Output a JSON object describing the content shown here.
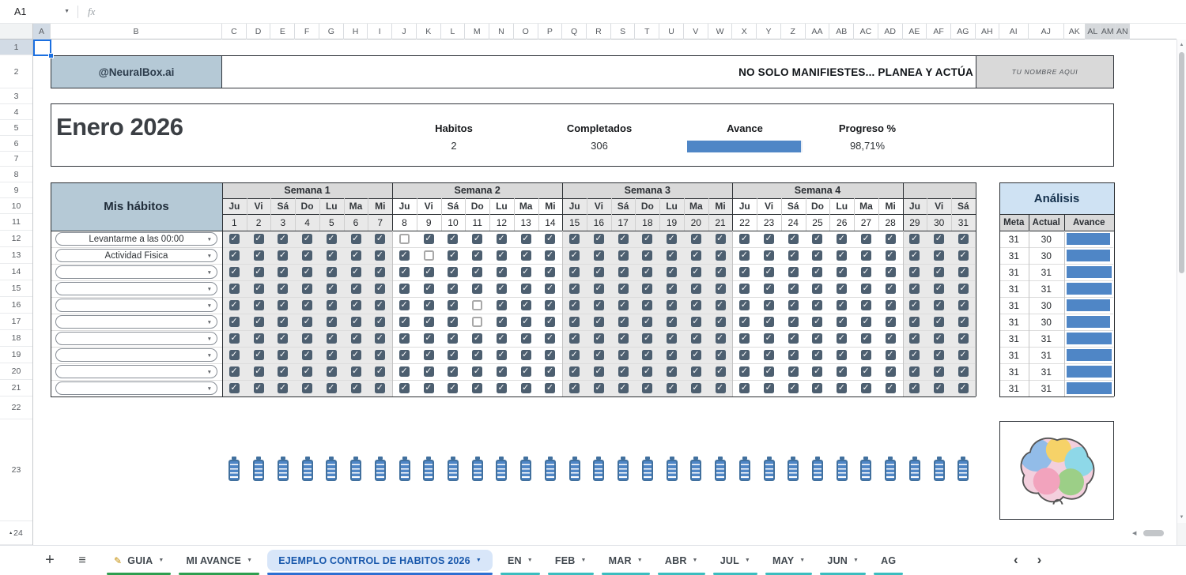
{
  "formula_bar": {
    "cell_ref": "A1",
    "fx_label": "fx"
  },
  "columns": [
    "A",
    "B",
    "C",
    "D",
    "E",
    "F",
    "G",
    "H",
    "I",
    "J",
    "K",
    "L",
    "M",
    "N",
    "O",
    "P",
    "Q",
    "R",
    "S",
    "T",
    "U",
    "V",
    "W",
    "X",
    "Y",
    "Z",
    "AA",
    "AB",
    "AC",
    "AD",
    "AE",
    "AF",
    "AG",
    "AH",
    "AI",
    "AJ",
    "AK",
    "AL",
    "AM",
    "AN"
  ],
  "rows": [
    "1",
    "2",
    "3",
    "4",
    "5",
    "6",
    "7",
    "8",
    "9",
    "10",
    "11",
    "12",
    "13",
    "14",
    "15",
    "16",
    "17",
    "18",
    "19",
    "20",
    "21",
    "22",
    "23",
    "24"
  ],
  "banner": {
    "brand": "@NeuralBox.ai",
    "motto": "NO SOLO MANIFIESTES... PLANEA Y ACTÚA",
    "name_placeholder": "TU NOMBRE AQUI"
  },
  "summary": {
    "month": "Enero 2026",
    "habits_label": "Habitos",
    "habits_value": "2",
    "completed_label": "Completados",
    "completed_value": "306",
    "avance_label": "Avance",
    "progress_label": "Progreso %",
    "progress_value": "98,71%",
    "progress_pct": 98.71
  },
  "tracker": {
    "title": "Mis hábitos",
    "weeks": [
      "Semana 1",
      "Semana 2",
      "Semana 3",
      "Semana 4"
    ],
    "day_letters": [
      "Ju",
      "Vi",
      "Sá",
      "Do",
      "Lu",
      "Ma",
      "Mi",
      "Ju",
      "Vi",
      "Sá",
      "Do",
      "Lu",
      "Ma",
      "Mi",
      "Ju",
      "Vi",
      "Sá",
      "Do",
      "Lu",
      "Ma",
      "Mi",
      "Ju",
      "Vi",
      "Sá",
      "Do",
      "Lu",
      "Ma",
      "Mi",
      "Ju",
      "Vi",
      "Sá"
    ],
    "day_numbers": [
      1,
      2,
      3,
      4,
      5,
      6,
      7,
      8,
      9,
      10,
      11,
      12,
      13,
      14,
      15,
      16,
      17,
      18,
      19,
      20,
      21,
      22,
      23,
      24,
      25,
      26,
      27,
      28,
      29,
      30,
      31
    ],
    "habits": [
      {
        "name": "Levantarme a las 00:00",
        "unchecked_days": [
          8
        ],
        "meta": 31,
        "actual": 30
      },
      {
        "name": "Actividad Fisica",
        "unchecked_days": [
          9
        ],
        "meta": 31,
        "actual": 30
      },
      {
        "name": "",
        "unchecked_days": [],
        "meta": 31,
        "actual": 31
      },
      {
        "name": "",
        "unchecked_days": [],
        "meta": 31,
        "actual": 31
      },
      {
        "name": "",
        "unchecked_days": [
          11
        ],
        "meta": 31,
        "actual": 30
      },
      {
        "name": "",
        "unchecked_days": [
          11
        ],
        "meta": 31,
        "actual": 30
      },
      {
        "name": "",
        "unchecked_days": [],
        "meta": 31,
        "actual": 31
      },
      {
        "name": "",
        "unchecked_days": [],
        "meta": 31,
        "actual": 31
      },
      {
        "name": "",
        "unchecked_days": [],
        "meta": 31,
        "actual": 31
      },
      {
        "name": "",
        "unchecked_days": [],
        "meta": 31,
        "actual": 31
      }
    ]
  },
  "analysis": {
    "title": "Análisis",
    "headers": [
      "Meta",
      "Actual",
      "Avance"
    ]
  },
  "footer_tabs": {
    "items": [
      {
        "label": "GUIA",
        "icon": "✎",
        "color": "#2e9e4f",
        "arrow": true,
        "active": false
      },
      {
        "label": "MI AVANCE",
        "color": "#2e9e4f",
        "arrow": true,
        "active": false
      },
      {
        "label": "EJEMPLO CONTROL DE HABITOS 2026",
        "color": "#2d6fd2",
        "arrow": true,
        "active": true
      },
      {
        "label": "EN",
        "color": "#3bbdbf",
        "arrow": true,
        "active": false
      },
      {
        "label": "FEB",
        "color": "#3bbdbf",
        "arrow": true,
        "active": false
      },
      {
        "label": "MAR",
        "color": "#3bbdbf",
        "arrow": true,
        "active": false
      },
      {
        "label": "ABR",
        "color": "#3bbdbf",
        "arrow": true,
        "active": false
      },
      {
        "label": "JUL",
        "color": "#3bbdbf",
        "arrow": true,
        "active": false
      },
      {
        "label": "MAY",
        "color": "#3bbdbf",
        "arrow": true,
        "active": false
      },
      {
        "label": "JUN",
        "color": "#3bbdbf",
        "arrow": true,
        "active": false
      },
      {
        "label": "AG",
        "color": "#3bbdbf",
        "arrow": false,
        "active": false
      }
    ]
  },
  "icons": {
    "name_box_arrow": "▼",
    "dropdown": "▼",
    "check": "✓",
    "plus": "+",
    "all_sheets": "≡",
    "nav_left": "‹",
    "nav_right": "›",
    "scroll_up": "▲",
    "scroll_down": "▼",
    "scroll_left": "◀",
    "row_group": "▴"
  },
  "colors": {
    "accent_blue": "#4f86c6",
    "checkbox_fill": "#4d5f70",
    "banner_blue": "#b5c9d6",
    "analysis_header_blue": "#cfe2f3",
    "header_gray": "#d9d9d9",
    "week_shade": "#e9e9e9",
    "selection_blue": "#1b6fe0"
  }
}
